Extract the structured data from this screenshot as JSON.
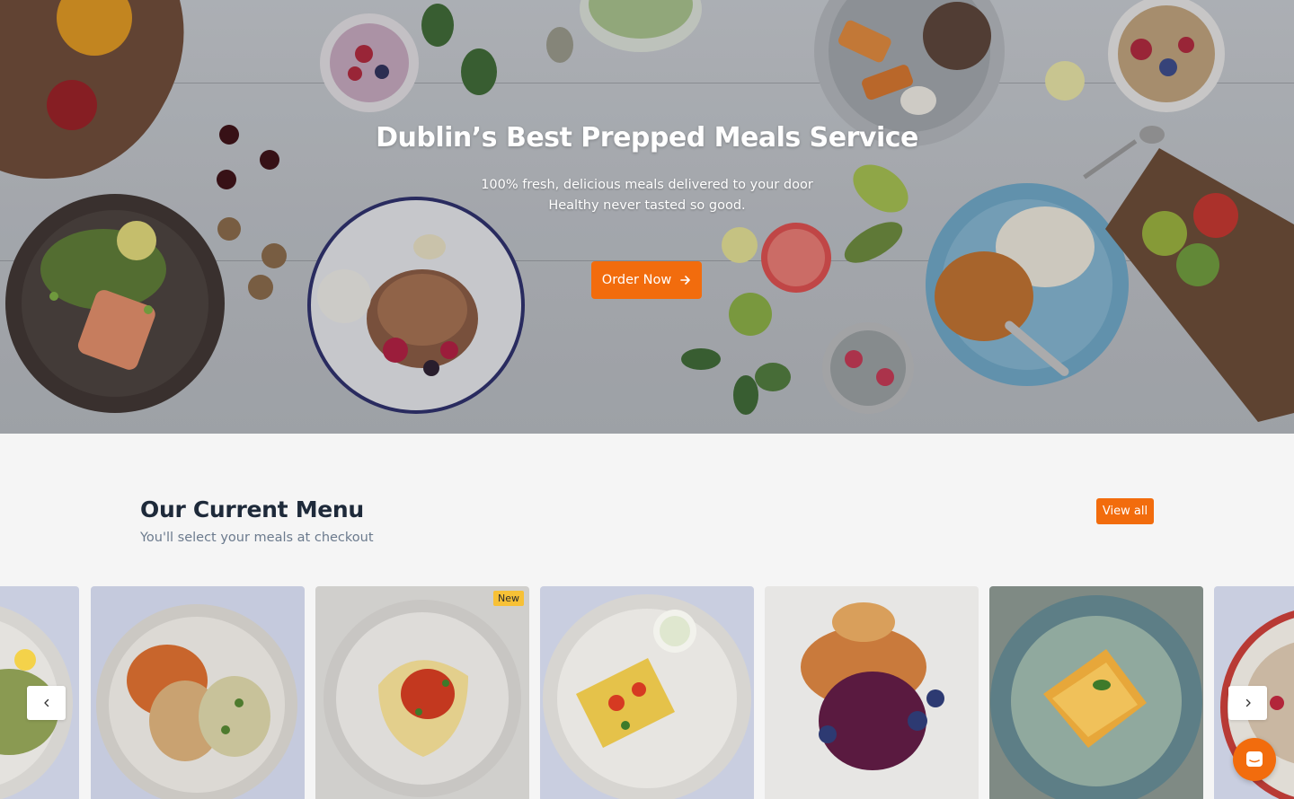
{
  "hero": {
    "title": "Dublin’s Best Prepped Meals Service",
    "subtitle_line1": "100% fresh, delicious meals delivered to your door",
    "subtitle_line2": "Healthy never tasted so good.",
    "cta_label": "Order Now",
    "cta_icon": "arrow-right-icon"
  },
  "menu": {
    "title": "Our Current Menu",
    "subtitle": "You'll select your meals at checkout",
    "view_all_label": "View all",
    "cards": [
      {
        "badge": ""
      },
      {
        "badge": ""
      },
      {
        "badge": "New"
      },
      {
        "badge": ""
      },
      {
        "badge": ""
      },
      {
        "badge": ""
      },
      {
        "badge": ""
      }
    ],
    "prev_icon": "chevron-left-icon",
    "next_icon": "chevron-right-icon"
  },
  "chat": {
    "icon": "chat-bubble-icon"
  },
  "colors": {
    "accent": "#f26c0d",
    "heading": "#1e2a3a",
    "muted": "#6b7a8d",
    "badge": "#f7c136",
    "section_bg": "#f5f5f5"
  }
}
